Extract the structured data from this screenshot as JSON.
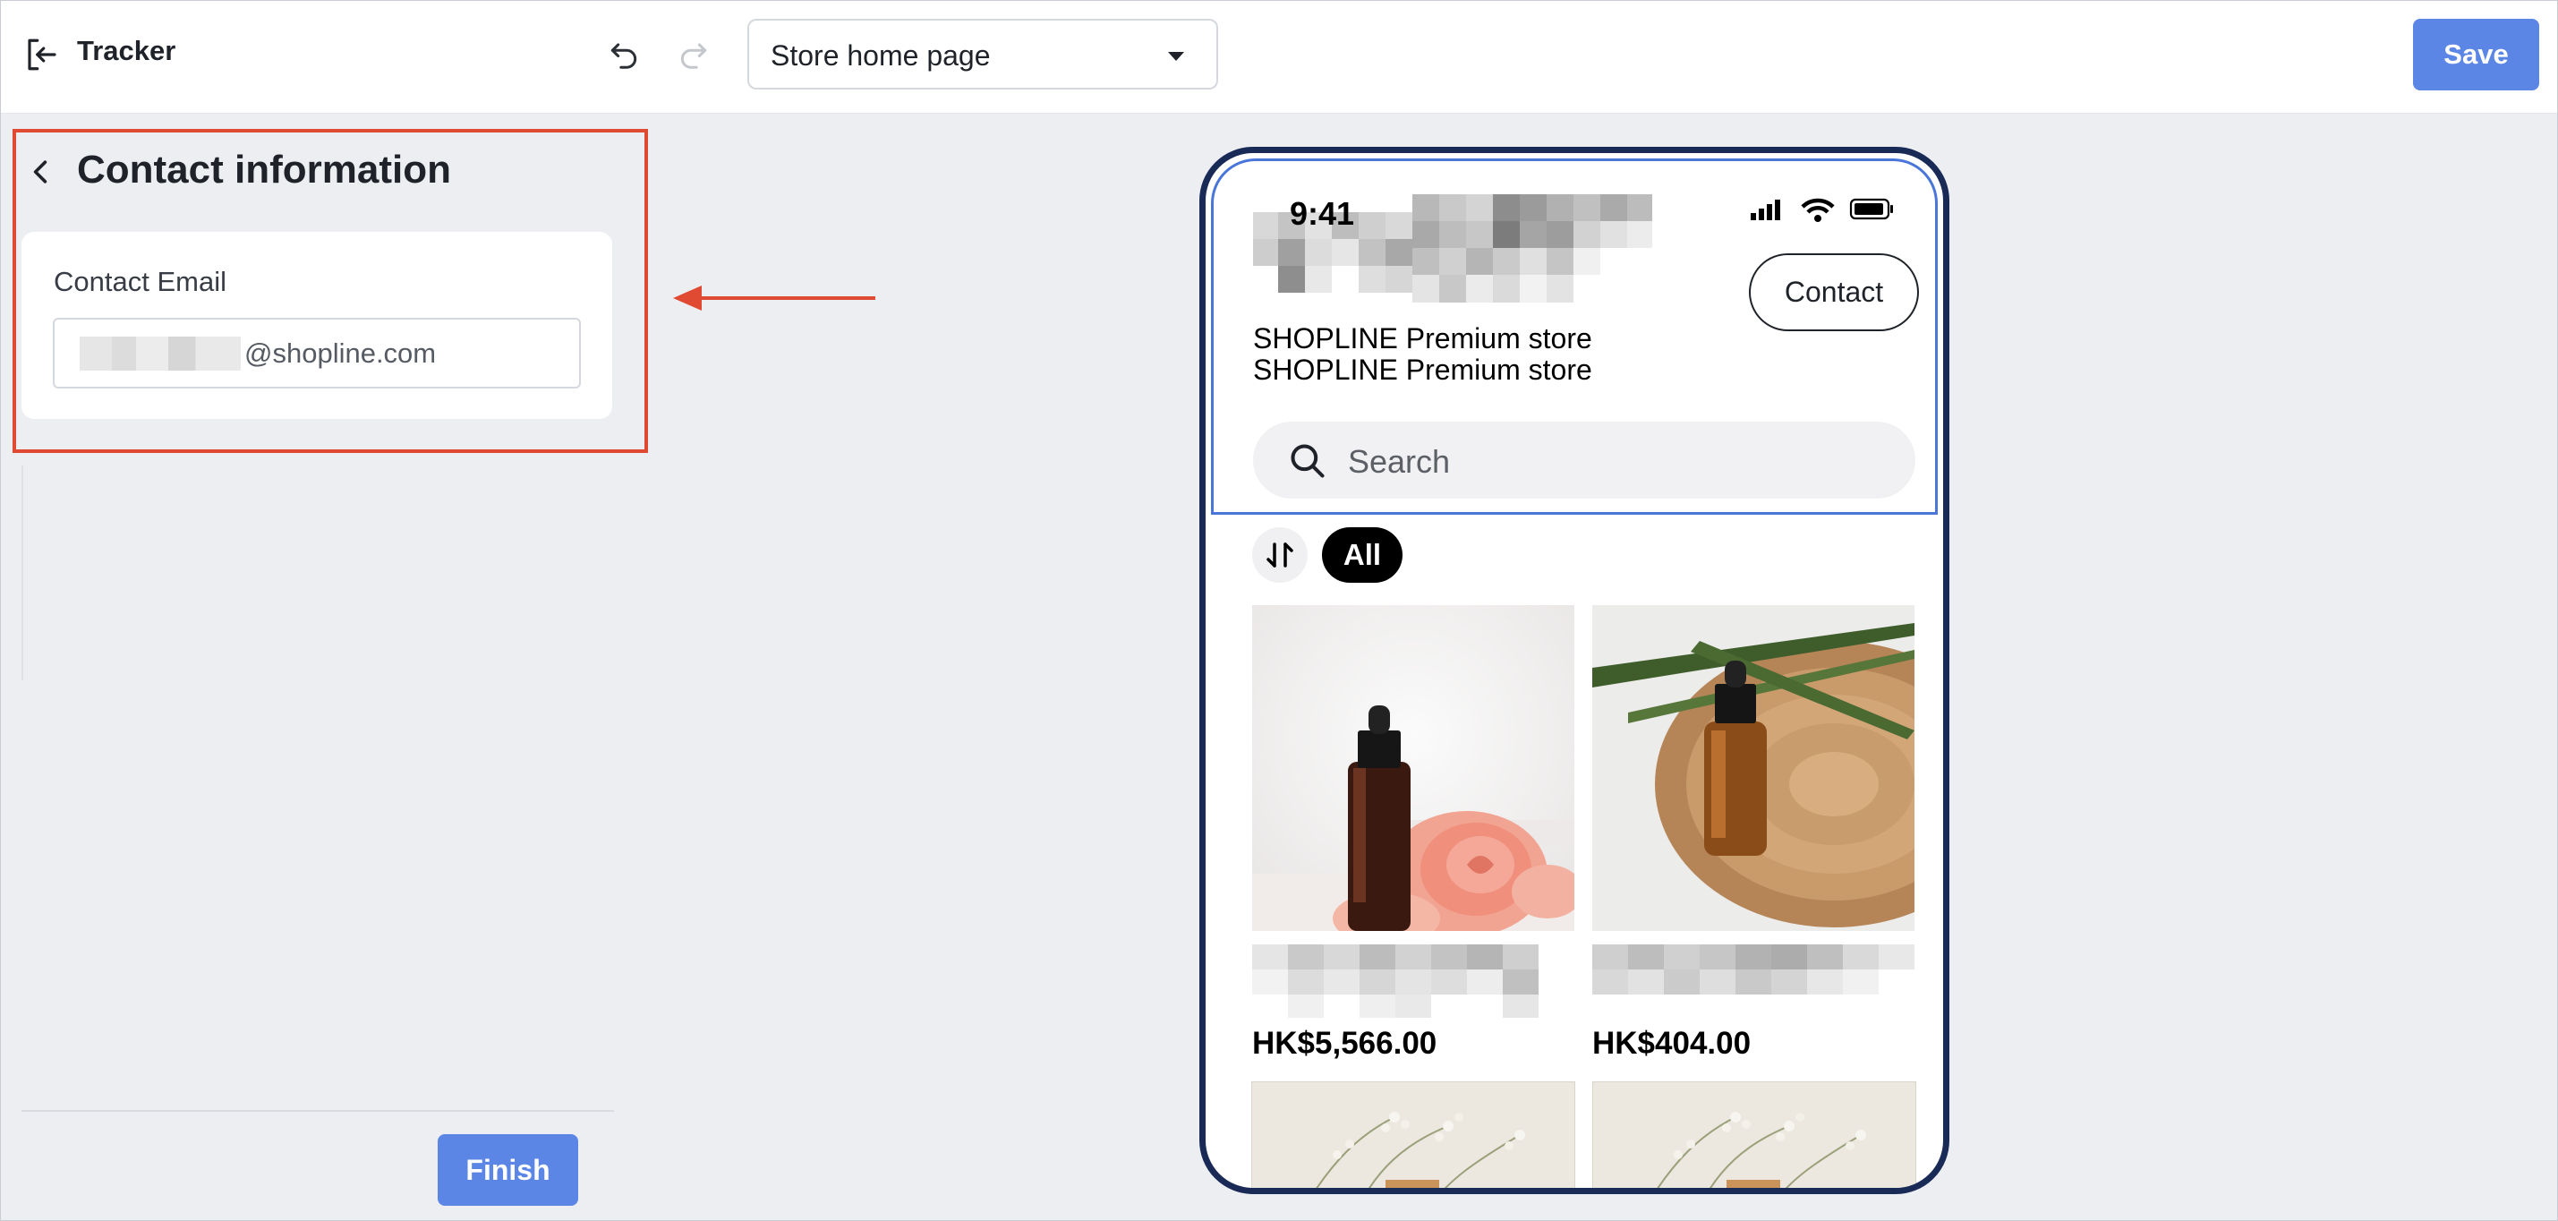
{
  "app": {
    "title": "Tracker",
    "page_select": {
      "value": "Store home page"
    },
    "save_label": "Save"
  },
  "panel": {
    "title": "Contact information",
    "email_label": "Contact Email",
    "email_value": "@shopline.com",
    "finish_label": "Finish"
  },
  "colors": {
    "primary": "#5b86e5",
    "highlight": "#e14a32",
    "phone_border": "#1a2a57"
  },
  "preview": {
    "status_time": "9:41",
    "store_name_line1": "SHOPLINE Premium store",
    "store_name_line2": "SHOPLINE Premium store",
    "contact_label": "Contact",
    "search_placeholder": "Search",
    "filter_all": "All",
    "products": [
      {
        "price": "HK$5,566.00",
        "image": "amber dropper bottle with pink rose"
      },
      {
        "price": "HK$404.00",
        "image": "amber dropper bottle on wood slice with leaves"
      },
      {
        "image": "dried baby's breath flowers"
      },
      {
        "image": "dried baby's breath flowers"
      }
    ]
  }
}
